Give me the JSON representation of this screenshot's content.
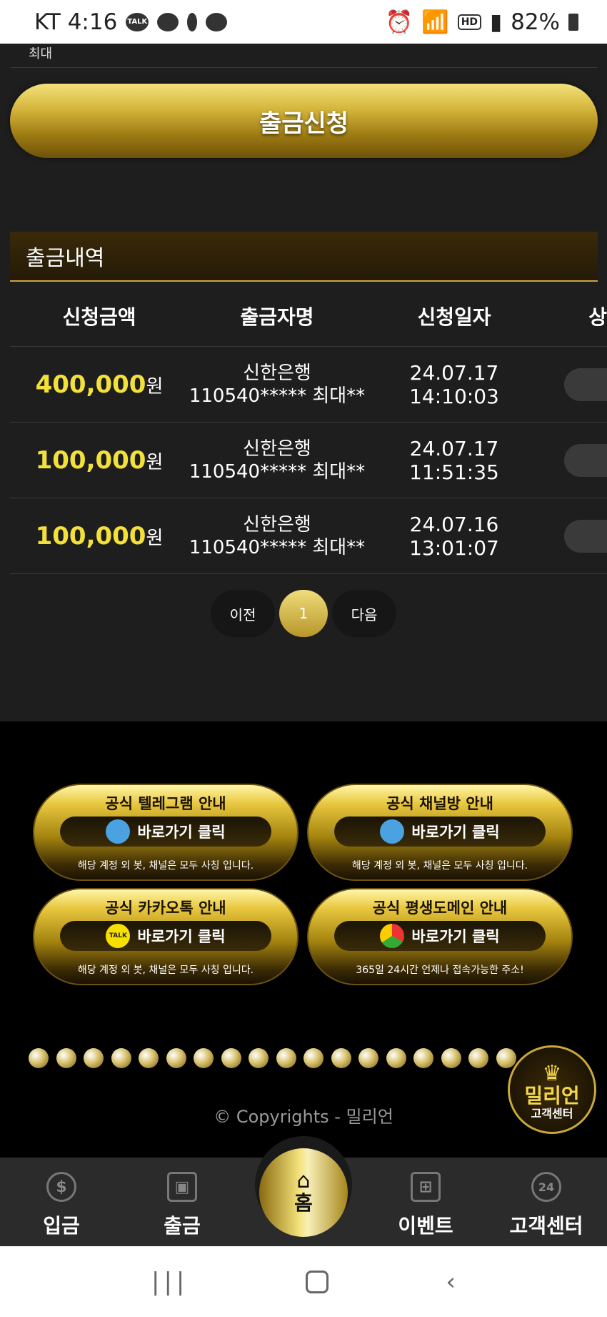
{
  "status_bar": {
    "carrier_time": "KT 4:16",
    "talk_icon": "TALK",
    "battery": "82%"
  },
  "top_label": "최대",
  "withdraw_button": "출금신청",
  "history": {
    "title": "출금내역",
    "columns": [
      "신청금액",
      "출금자명",
      "신청일자",
      "상"
    ],
    "rows": [
      {
        "amount": "400,000",
        "unit": "원",
        "bank": "신한은행",
        "account": "110540***** 최대**",
        "date": "24.07.17 14:10:03"
      },
      {
        "amount": "100,000",
        "unit": "원",
        "bank": "신한은행",
        "account": "110540***** 최대**",
        "date": "24.07.17 11:51:35"
      },
      {
        "amount": "100,000",
        "unit": "원",
        "bank": "신한은행",
        "account": "110540***** 최대**",
        "date": "24.07.16 13:01:07"
      }
    ]
  },
  "pagination": {
    "prev": "이전",
    "current": "1",
    "next": "다음"
  },
  "banners": [
    {
      "title": "공식 텔레그램 안내",
      "button": "바로가기 클릭",
      "sub": "해당 계정 외 봇, 채널은 모두 사칭 입니다.",
      "icon": "telegram-icon"
    },
    {
      "title": "공식 채널방 안내",
      "button": "바로가기 클릭",
      "sub": "해당 계정 외 봇, 채널은 모두 사칭 입니다.",
      "icon": "telegram-icon"
    },
    {
      "title": "공식 카카오톡 안내",
      "button": "바로가기 클릭",
      "sub": "해당 계정 외 봇, 채널은 모두 사칭 입니다.",
      "icon": "kakaotalk-icon",
      "icon_text": "TALK"
    },
    {
      "title": "공식 평생도메인 안내",
      "button": "바로가기 클릭",
      "sub": "365일 24시간 언제나 접속가능한 주소!",
      "icon": "chrome-icon"
    }
  ],
  "copyright": "© Copyrights - 밀리언",
  "cs_badge": {
    "brand": "밀리언",
    "label": "고객센터"
  },
  "bottom_nav": [
    {
      "label": "입금",
      "icon": "dollar-icon"
    },
    {
      "label": "출금",
      "icon": "wallet-icon"
    },
    {
      "label": "홈",
      "icon": "home-icon"
    },
    {
      "label": "이벤트",
      "icon": "gift-icon"
    },
    {
      "label": "고객센터",
      "icon": "support-24-icon"
    }
  ],
  "colors": {
    "gold": "#c9a73a",
    "amount_yellow": "#f3e13a",
    "background": "#1e1e1e"
  }
}
